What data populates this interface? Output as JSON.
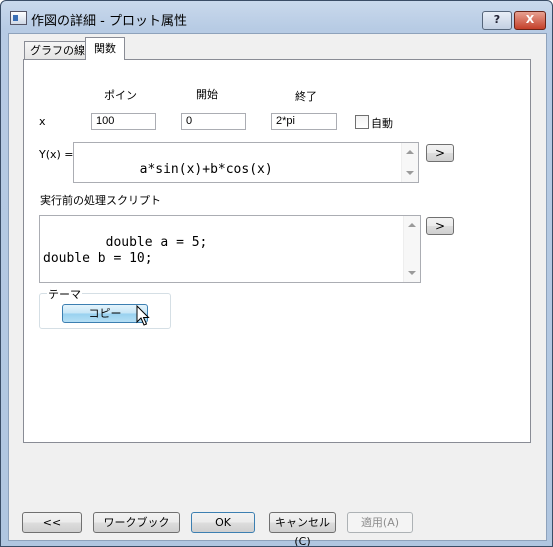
{
  "window": {
    "title": "作図の詳細 - プロット属性",
    "help_label": "?",
    "close_label": "X"
  },
  "tabs": [
    {
      "label": "グラフの線",
      "active": false
    },
    {
      "label": "関数",
      "active": true
    }
  ],
  "range": {
    "header_points": "ポイン",
    "header_start": "開始",
    "header_end": "終了",
    "row_label": "x",
    "points": "100",
    "start": "0",
    "end": "2*pi",
    "auto_label": "自動",
    "auto_checked": false
  },
  "function": {
    "label": "Y(x) =",
    "expression": "a*sin(x)+b*cos(x)",
    "arrow_label": ">"
  },
  "script": {
    "label": "実行前の処理スクリプト",
    "code": "double a = 5;\ndouble b = 10;",
    "arrow_label": ">"
  },
  "theme": {
    "label": "テーマ",
    "copy_label": "コピー"
  },
  "footer": {
    "back_label": "<<",
    "workbook_label": "ワークブック",
    "ok_label": "OK",
    "cancel_label": "キャンセル(C)",
    "apply_label": "適用(A)"
  }
}
